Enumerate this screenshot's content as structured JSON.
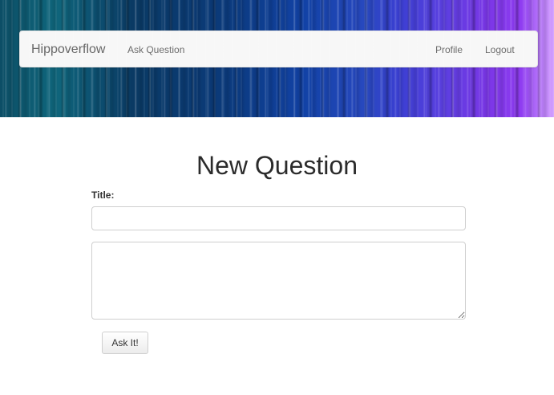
{
  "header": {
    "brand": "Hippoverflow",
    "nav": {
      "ask_question": "Ask Question",
      "profile": "Profile",
      "logout": "Logout"
    }
  },
  "page": {
    "title": "New Question"
  },
  "form": {
    "title_label": "Title:",
    "title_value": "",
    "body_value": "",
    "submit_label": "Ask It!"
  }
}
